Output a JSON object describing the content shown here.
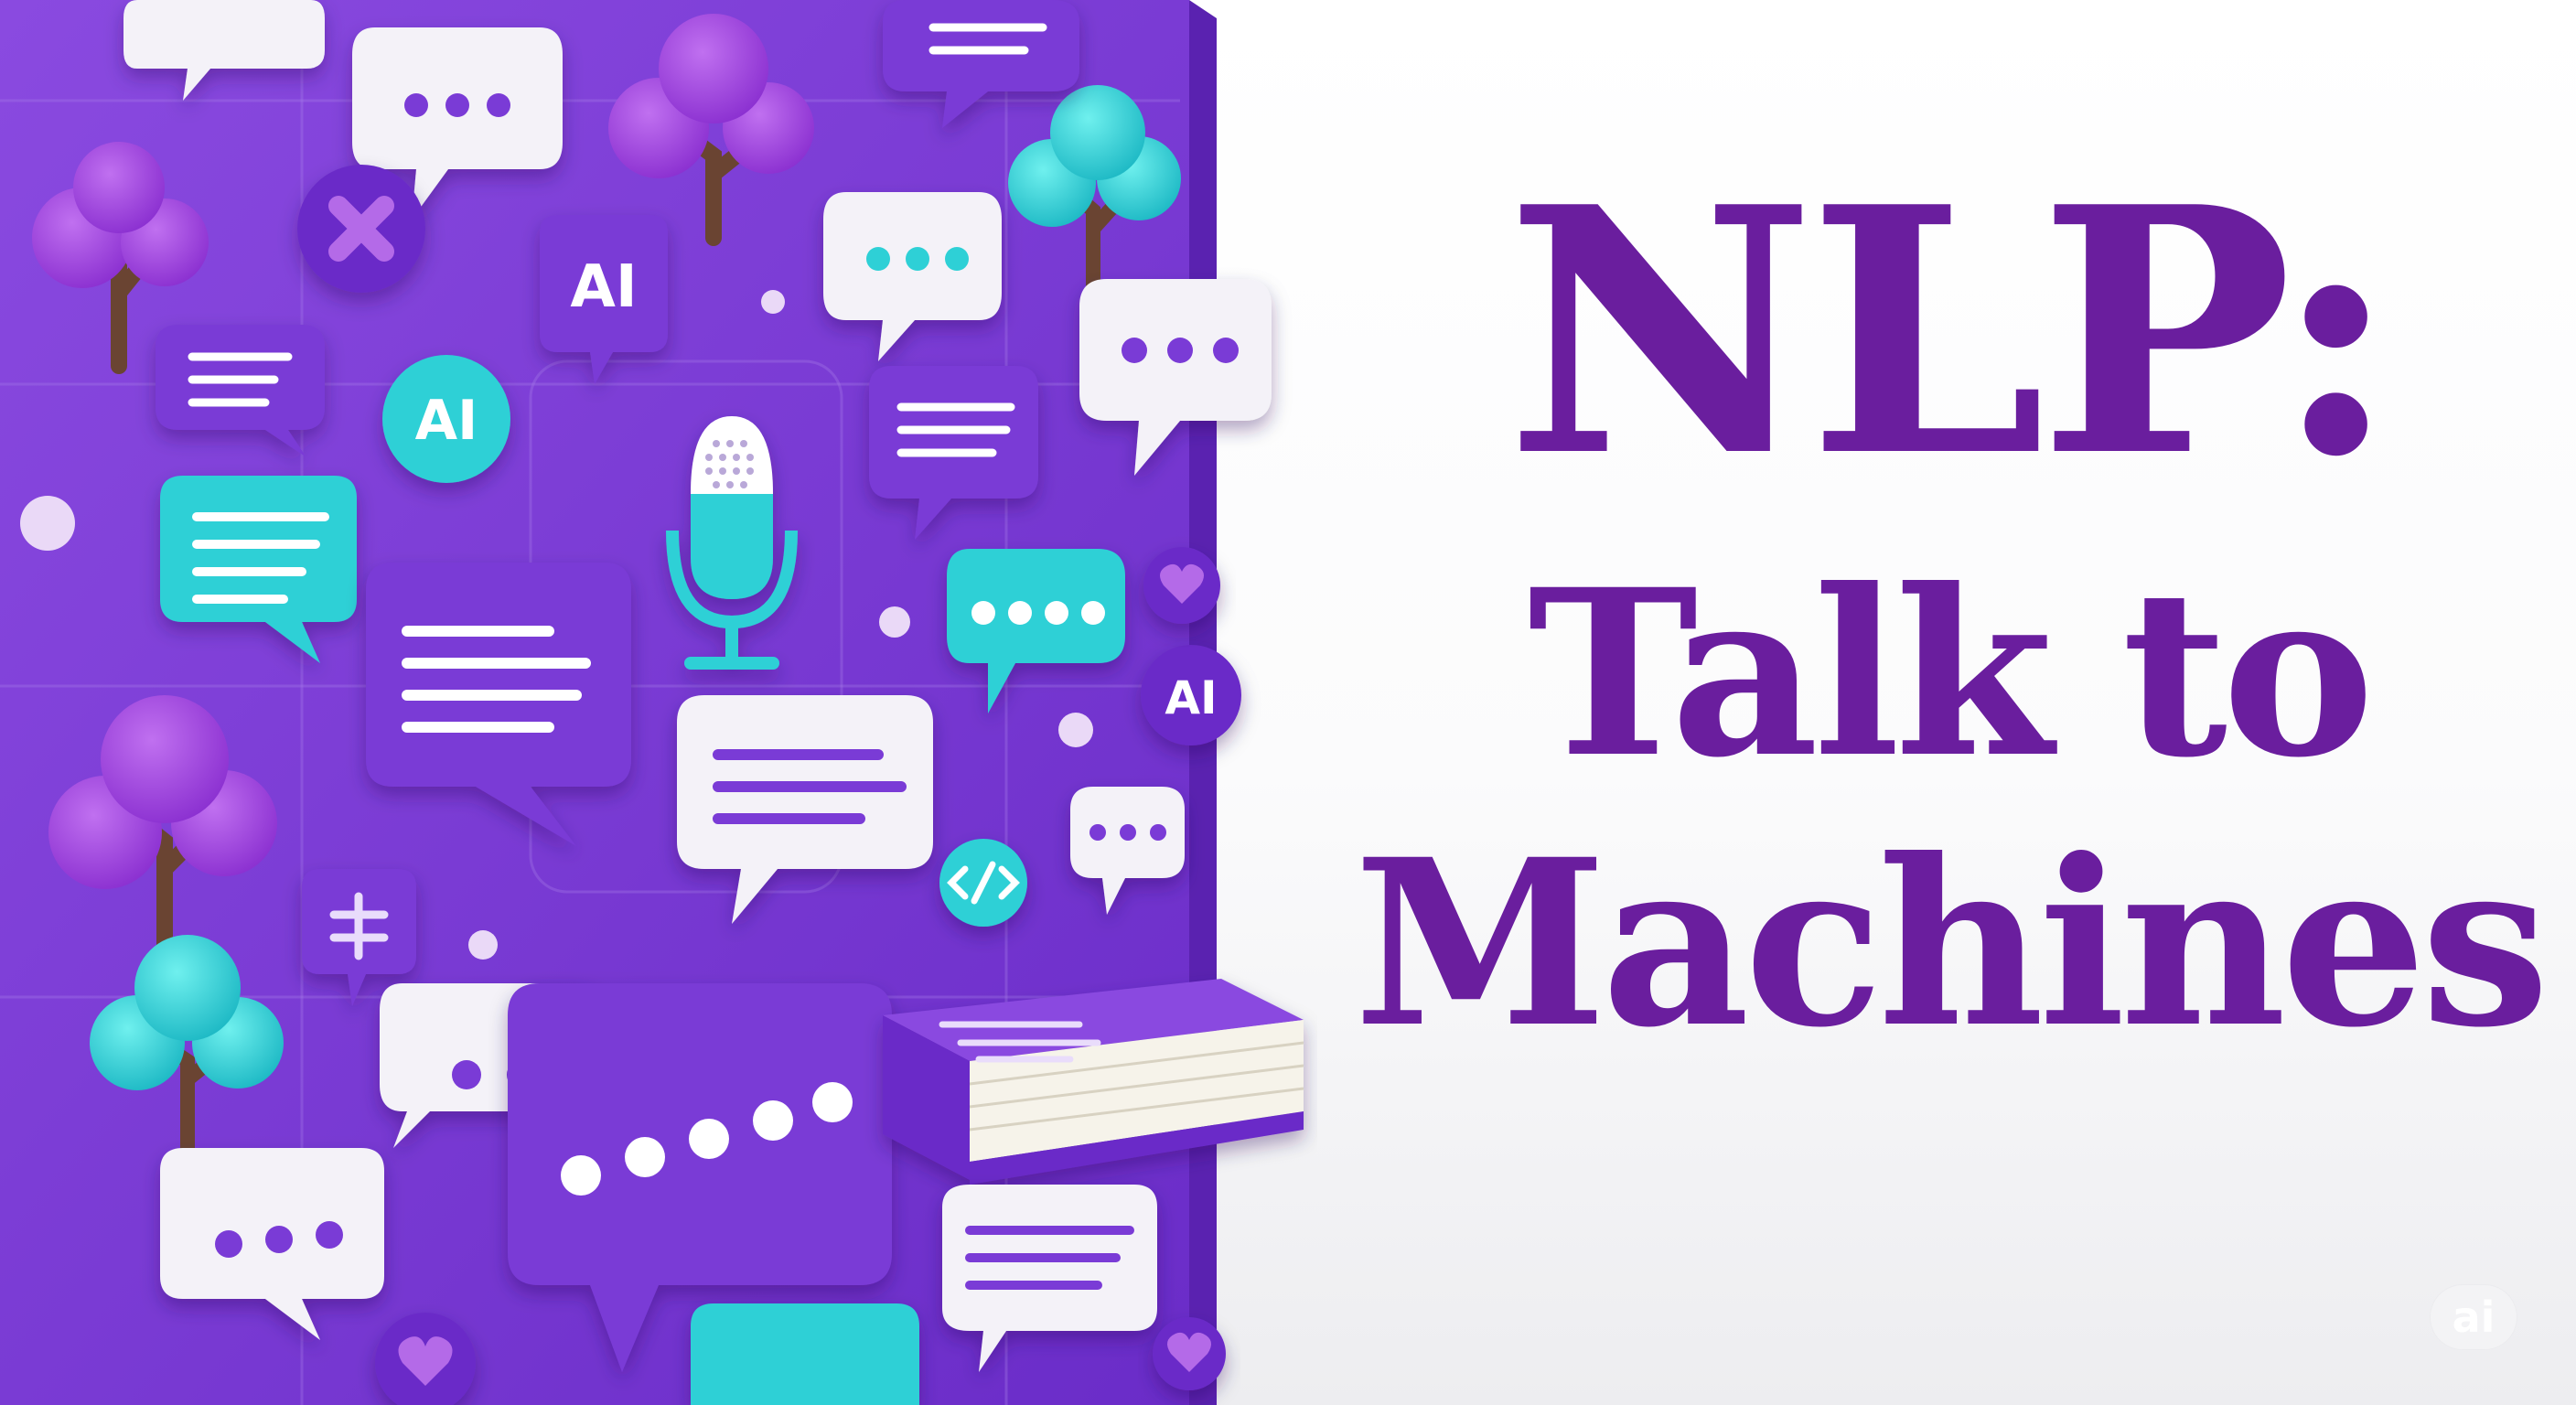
{
  "title": {
    "line1": "NLP:",
    "line2": "Talk to",
    "line3": "Machines"
  },
  "illustration": {
    "badge_label": "AI",
    "icons": [
      "speech-bubble-icon",
      "microphone-icon",
      "book-icon",
      "tree-icon",
      "heart-icon",
      "ai-badge-icon",
      "code-icon",
      "divide-icon"
    ]
  },
  "watermark": {
    "label": "ai"
  },
  "colors": {
    "panel": "#7a3ad6",
    "panel_dark": "#5a22b0",
    "teal": "#2fd0d6",
    "white_bubble": "#f4f2f8",
    "title": "#6a1e9e",
    "trunk": "#6a4432"
  }
}
